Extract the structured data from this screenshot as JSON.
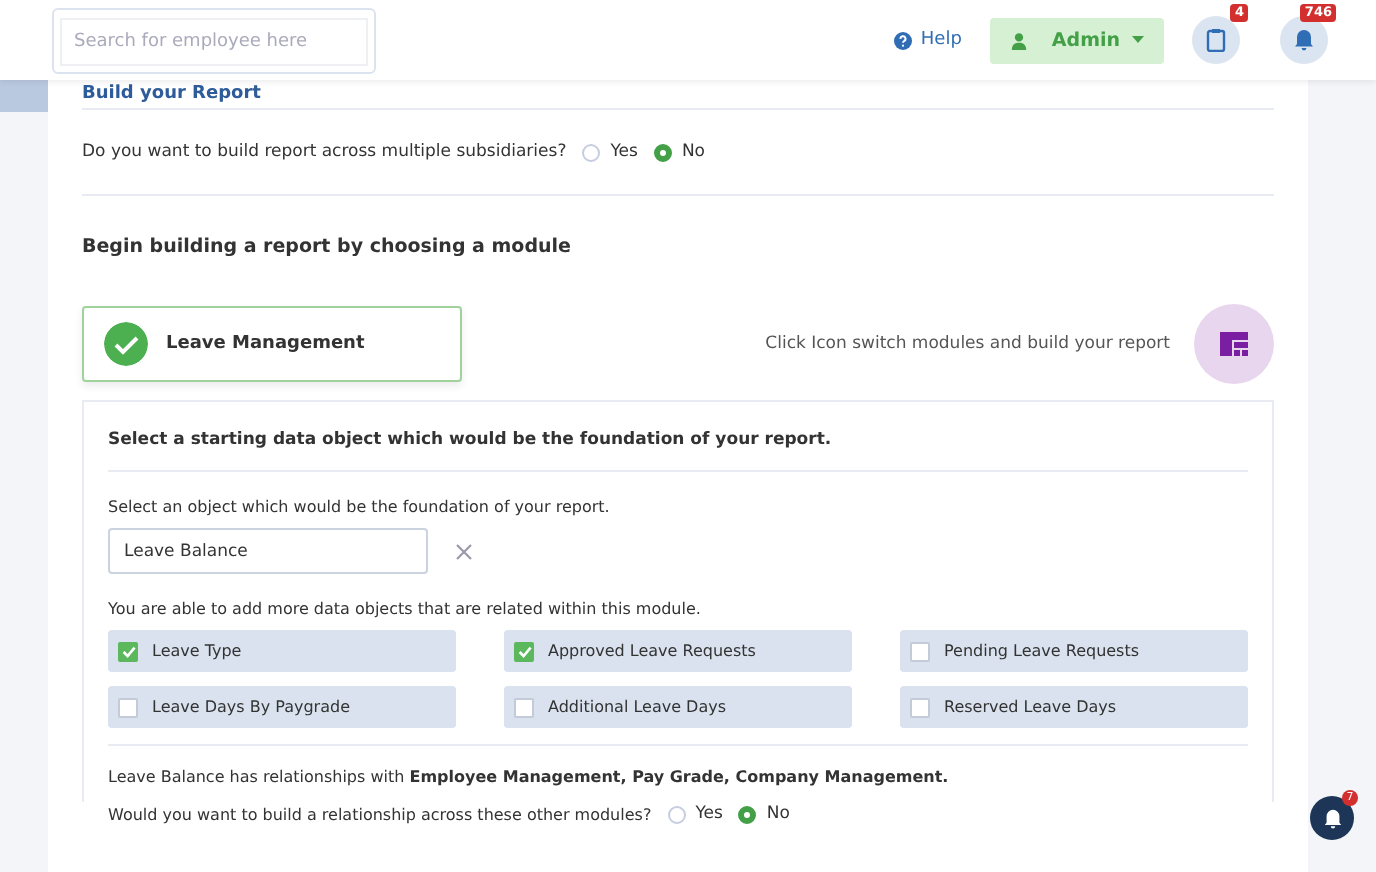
{
  "header": {
    "search": {
      "placeholder": "Search for employee here"
    },
    "help": "Help",
    "user": "Admin",
    "tasks_badge": "4",
    "notifications_badge": "746"
  },
  "section_title": "Build your Report",
  "subsidiaries": {
    "question": "Do you want to build report across multiple subsidiaries?",
    "options": [
      {
        "label": "Yes",
        "selected": false
      },
      {
        "label": "No",
        "selected": true
      }
    ]
  },
  "module_heading": "Begin building a report by choosing a module",
  "module": {
    "name": "Leave Management",
    "checked": true
  },
  "switch_hint": "Click Icon switch modules and build your report",
  "object_panel": {
    "title": "Select a starting data object which would be the foundation of your report.",
    "field_label": "Select an object which would be the foundation of your report.",
    "field_value": "Leave Balance",
    "related_label": "You are able to add more data objects that are related within this module.",
    "objects": [
      {
        "label": "Leave Type",
        "checked": true
      },
      {
        "label": "Approved Leave Requests",
        "checked": true
      },
      {
        "label": "Pending Leave Requests",
        "checked": false
      },
      {
        "label": "Leave Days By Paygrade",
        "checked": false
      },
      {
        "label": "Additional Leave Days",
        "checked": false
      },
      {
        "label": "Reserved Leave Days",
        "checked": false
      }
    ],
    "relationships": "Leave Balance has relationships with **Employee Management, Pay Grade, Company Management.**",
    "relationship_question": "Would you want to build a relationship across these other modules?",
    "relationship_options": [
      {
        "label": "Yes",
        "selected": false
      },
      {
        "label": "No",
        "selected": true
      }
    ]
  },
  "chat_badge": "7"
}
